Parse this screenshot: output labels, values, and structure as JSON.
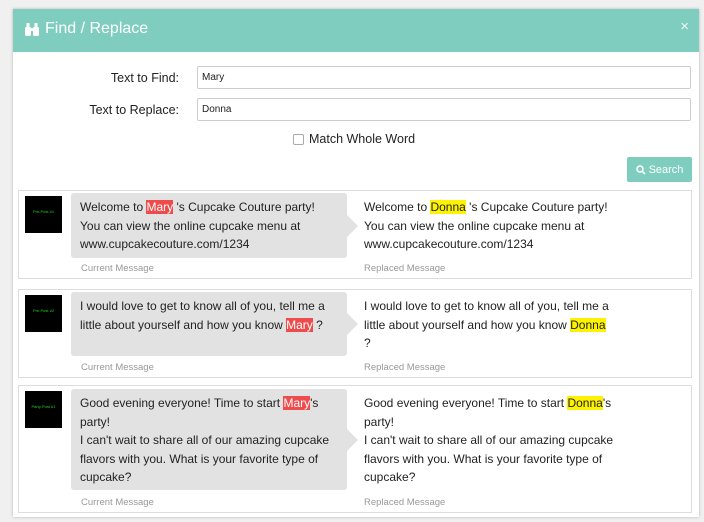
{
  "dialog": {
    "title": "Find / Replace",
    "close_symbol": "×"
  },
  "form": {
    "find_label": "Text to Find:",
    "find_value": "Mary",
    "replace_label": "Text to Replace:",
    "replace_value": "Donna",
    "match_whole_word_label": "Match Whole Word",
    "match_whole_word_checked": false,
    "search_label": "Search"
  },
  "colors": {
    "header": "#7ecdbe",
    "find_highlight": "#ee4c4c",
    "replace_highlight": "#fdf200",
    "bubble": "#e2e2e2"
  },
  "messages": [
    {
      "avatar_text": "Pre-Post #1",
      "current_label": "Current Message",
      "replaced_label": "Replaced Message",
      "current": {
        "before": "Welcome to ",
        "match": "Mary",
        "after": " 's Cupcake Couture party!\nYou can view the online cupcake menu at\nwww.cupcakecouture.com/1234"
      },
      "replaced": {
        "before": "Welcome to ",
        "match": "Donna",
        "after": " 's Cupcake Couture party!\nYou can view the online cupcake menu at\nwww.cupcakecouture.com/1234"
      }
    },
    {
      "avatar_text": "Pre-Post #2",
      "current_label": "Current Message",
      "replaced_label": "Replaced Message",
      "current": {
        "before": "I would love to get to know all of you, tell me a\nlittle about yourself and how you know ",
        "match": "Mary",
        "after": " ?"
      },
      "replaced": {
        "before": "I would love to get to know all of you, tell me a\nlittle about yourself and how you know ",
        "match": "Donna",
        "after": "\n?"
      }
    },
    {
      "avatar_text": "Party Post #1",
      "current_label": "Current Message",
      "replaced_label": "Replaced Message",
      "current": {
        "before": "Good evening everyone! Time to start ",
        "match": "Mary",
        "after": "'s\nparty!\nI can't wait to share all of our amazing cupcake\nflavors with you. What is your favorite type of\ncupcake?"
      },
      "replaced": {
        "before": "Good evening everyone! Time to start ",
        "match": "Donna",
        "after": "'s\nparty!\nI can't wait to share all of our amazing cupcake\nflavors with you. What is your favorite type of\ncupcake?"
      }
    }
  ]
}
